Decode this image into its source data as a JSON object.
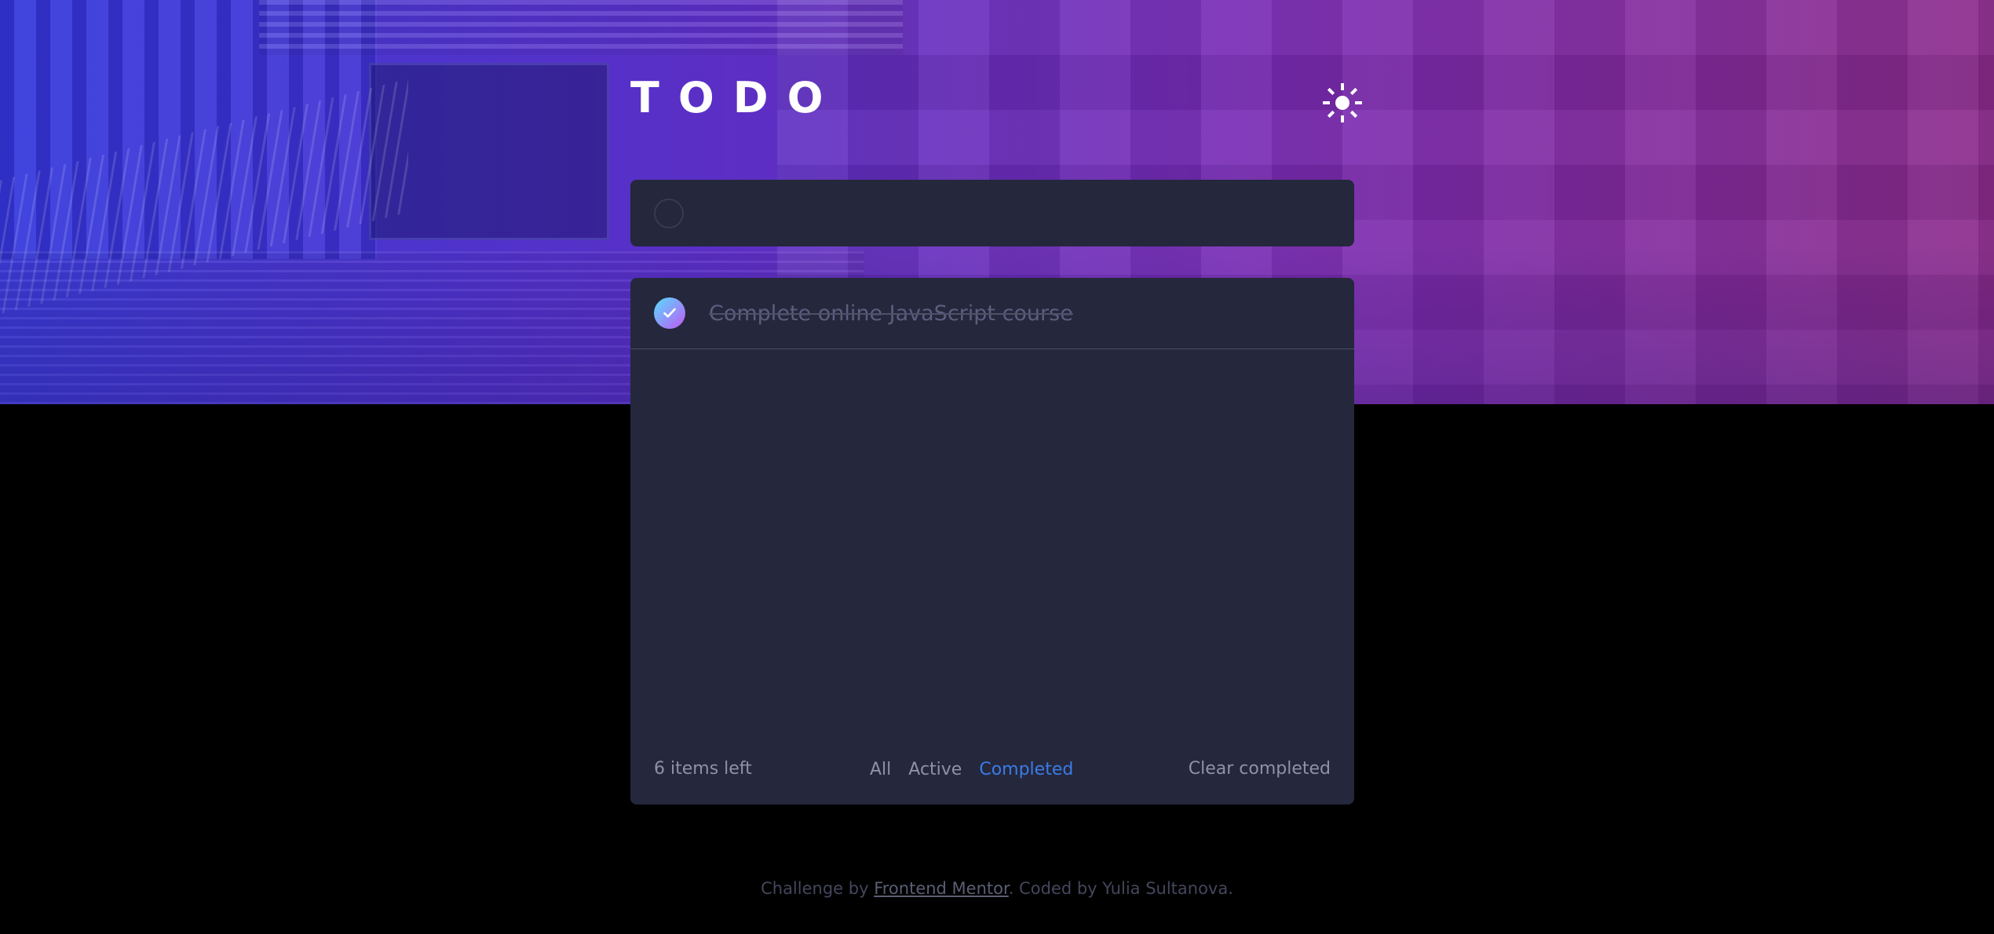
{
  "app": {
    "title": "TODO"
  },
  "header": {
    "theme_toggle_icon": "sun-icon"
  },
  "new_todo": {
    "placeholder": "",
    "value": ""
  },
  "todos": [
    {
      "text": "Complete online JavaScript course",
      "completed": true
    }
  ],
  "footer": {
    "items_left": "6 items left",
    "filters": [
      "All",
      "Active",
      "Completed"
    ],
    "active_filter": "Completed",
    "clear_label": "Clear completed"
  },
  "attribution": {
    "prefix": "Challenge by ",
    "link": "Frontend Mentor",
    "suffix": ". Coded by Yulia Sultanova."
  },
  "colors": {
    "page_bg": "#000000",
    "card_bg": "#25273c",
    "accent_blue": "#3a7ce6",
    "check_gradient_start": "#57ddff",
    "check_gradient_end": "#c058f3",
    "hero_gradient_left": "#3a3bd6",
    "hero_gradient_right": "#8a2a8a"
  }
}
